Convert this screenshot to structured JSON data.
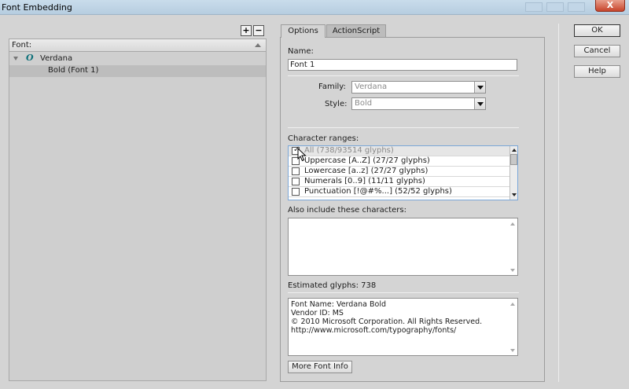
{
  "window": {
    "title": "Font Embedding",
    "close_glyph": "X"
  },
  "font_list": {
    "header": "Font:",
    "add_glyph": "+",
    "remove_glyph": "−",
    "family": "Verdana",
    "family_icon": "O",
    "style_item": "Bold (Font 1)"
  },
  "tabs": [
    {
      "label": "Options",
      "active": true
    },
    {
      "label": "ActionScript",
      "active": false
    }
  ],
  "options": {
    "name_label": "Name:",
    "name_value": "Font 1",
    "family_label": "Family:",
    "family_value": "Verdana",
    "style_label": "Style:",
    "style_value": "Bold",
    "ranges_label": "Character ranges:",
    "ranges": [
      {
        "label": "All  (738/93514 glyphs)",
        "checked": true
      },
      {
        "label": "Uppercase [A..Z]  (27/27 glyphs)",
        "checked": false
      },
      {
        "label": "Lowercase [a..z]  (27/27 glyphs)",
        "checked": false
      },
      {
        "label": "Numerals [0..9]  (11/11 glyphs)",
        "checked": false
      },
      {
        "label": "Punctuation [!@#%...]  (52/52 glyphs)",
        "checked": false
      }
    ],
    "also_include_label": "Also include these characters:",
    "also_include_value": "",
    "estimated_glyphs": "Estimated glyphs: 738",
    "font_info_lines": [
      "Font Name: Verdana Bold",
      "Vendor ID: MS",
      "© 2010 Microsoft Corporation. All Rights Reserved.",
      "http://www.microsoft.com/typography/fonts/"
    ],
    "more_font_info_button": "More Font Info"
  },
  "buttons": {
    "ok": "OK",
    "cancel": "Cancel",
    "help": "Help"
  }
}
